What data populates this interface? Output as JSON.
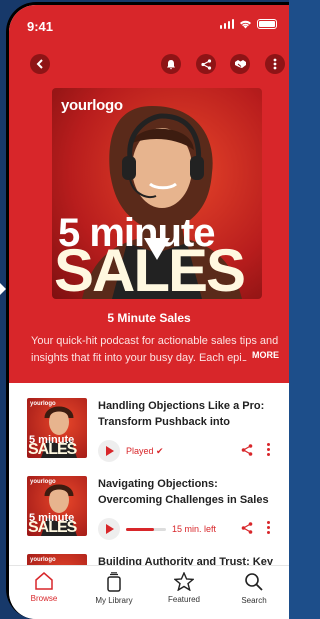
{
  "status_bar": {
    "time": "9:41"
  },
  "podcast": {
    "cover_logo": "yourlogo",
    "cover_line1": "5 minute",
    "cover_line2": "SALES",
    "title": "5 Minute Sales",
    "description": "Your quick-hit podcast for actionable sales tips and insights that fit into your busy day. Each epis",
    "more_label": "MORE"
  },
  "episodes": [
    {
      "title": "Handling Objections Like a Pro: Transform Pushback into Opportun...",
      "status": "Played",
      "check": "✔"
    },
    {
      "title": "Navigating Objections: Overcoming Challenges in Sales Conversations ...",
      "status": "15 min. left",
      "progress": 0.7
    },
    {
      "title": "Building Authority and Trust: Key"
    }
  ],
  "thumb": {
    "logo": "yourlogo",
    "line1": "5 minute",
    "line2": "SALES"
  },
  "tabs": [
    {
      "label": "Browse",
      "icon": "home-icon",
      "active": true
    },
    {
      "label": "My Library",
      "icon": "library-icon"
    },
    {
      "label": "Featured",
      "icon": "star-icon"
    },
    {
      "label": "Search",
      "icon": "search-icon"
    }
  ],
  "colors": {
    "accent": "#d8262a",
    "dark_accent": "#8e1416"
  }
}
